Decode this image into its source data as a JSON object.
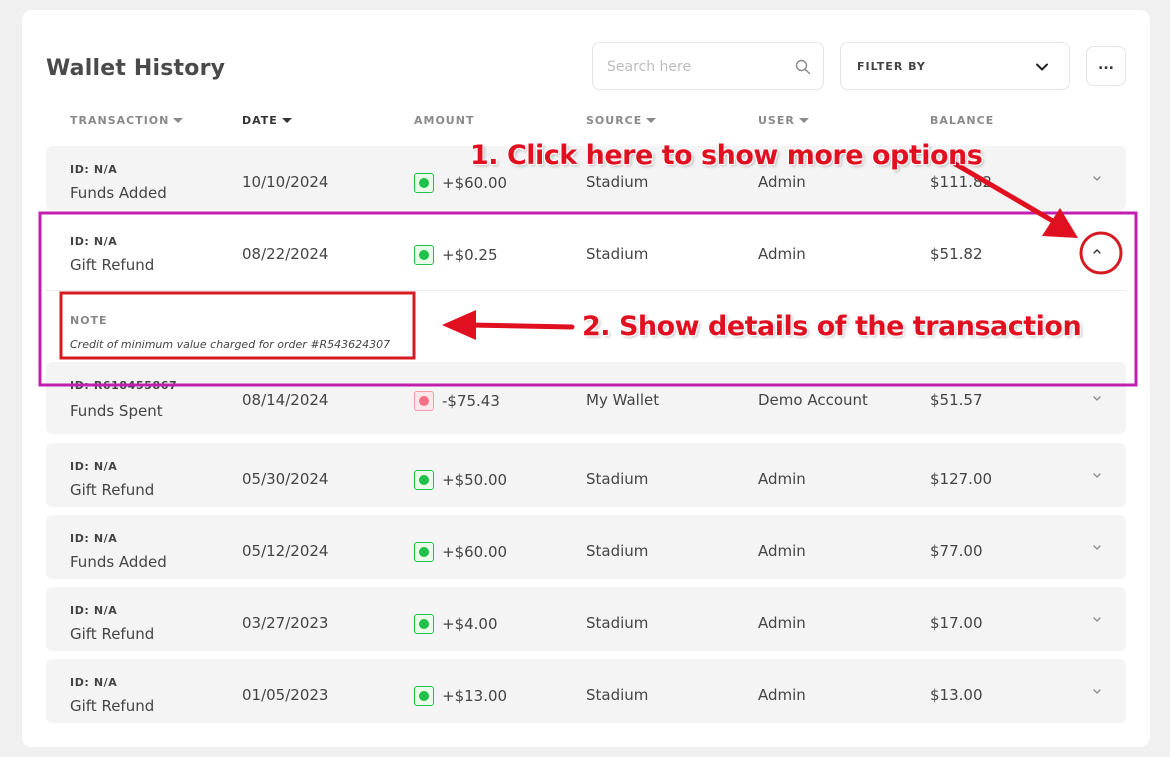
{
  "header": {
    "title": "Wallet History",
    "search_placeholder": "Search here",
    "filter_label": "FILTER BY",
    "more_label": "..."
  },
  "columns": [
    {
      "label": "TRANSACTION",
      "sortable": true
    },
    {
      "label": "DATE",
      "sortable": true,
      "active": true
    },
    {
      "label": "AMOUNT",
      "sortable": false
    },
    {
      "label": "SOURCE",
      "sortable": true
    },
    {
      "label": "USER",
      "sortable": true
    },
    {
      "label": "BALANCE",
      "sortable": false
    }
  ],
  "rows": [
    {
      "id": "ID: N/A",
      "type": "Funds Added",
      "date": "10/10/2024",
      "amount": "+$60.00",
      "sign": "positive",
      "source": "Stadium",
      "user": "Admin",
      "balance": "$111.82"
    },
    {
      "id": "ID: N/A",
      "type": "Gift Refund",
      "date": "08/22/2024",
      "amount": "+$0.25",
      "sign": "positive",
      "source": "Stadium",
      "user": "Admin",
      "balance": "$51.82",
      "expanded": true,
      "note_label": "NOTE",
      "note": "Credit of minimum value charged for order #R543624307"
    },
    {
      "id": "ID: R618455867",
      "type": "Funds Spent",
      "date": "08/14/2024",
      "amount": "-$75.43",
      "sign": "negative",
      "source": "My Wallet",
      "user": "Demo Account",
      "balance": "$51.57"
    },
    {
      "id": "ID: N/A",
      "type": "Gift Refund",
      "date": "05/30/2024",
      "amount": "+$50.00",
      "sign": "positive",
      "source": "Stadium",
      "user": "Admin",
      "balance": "$127.00"
    },
    {
      "id": "ID: N/A",
      "type": "Funds Added",
      "date": "05/12/2024",
      "amount": "+$60.00",
      "sign": "positive",
      "source": "Stadium",
      "user": "Admin",
      "balance": "$77.00"
    },
    {
      "id": "ID: N/A",
      "type": "Gift Refund",
      "date": "03/27/2023",
      "amount": "+$4.00",
      "sign": "positive",
      "source": "Stadium",
      "user": "Admin",
      "balance": "$17.00"
    },
    {
      "id": "ID: N/A",
      "type": "Gift Refund",
      "date": "01/05/2023",
      "amount": "+$13.00",
      "sign": "positive",
      "source": "Stadium",
      "user": "Admin",
      "balance": "$13.00"
    }
  ],
  "annotations": {
    "step1": "1. Click here to show more options",
    "step2": "2. Show details of the transaction",
    "color": "#e01020",
    "highlight_color": "#c020b0"
  },
  "colors": {
    "positive": "#1ec24a",
    "negative": "#f47087",
    "row_bg": "#f4f4f4"
  }
}
